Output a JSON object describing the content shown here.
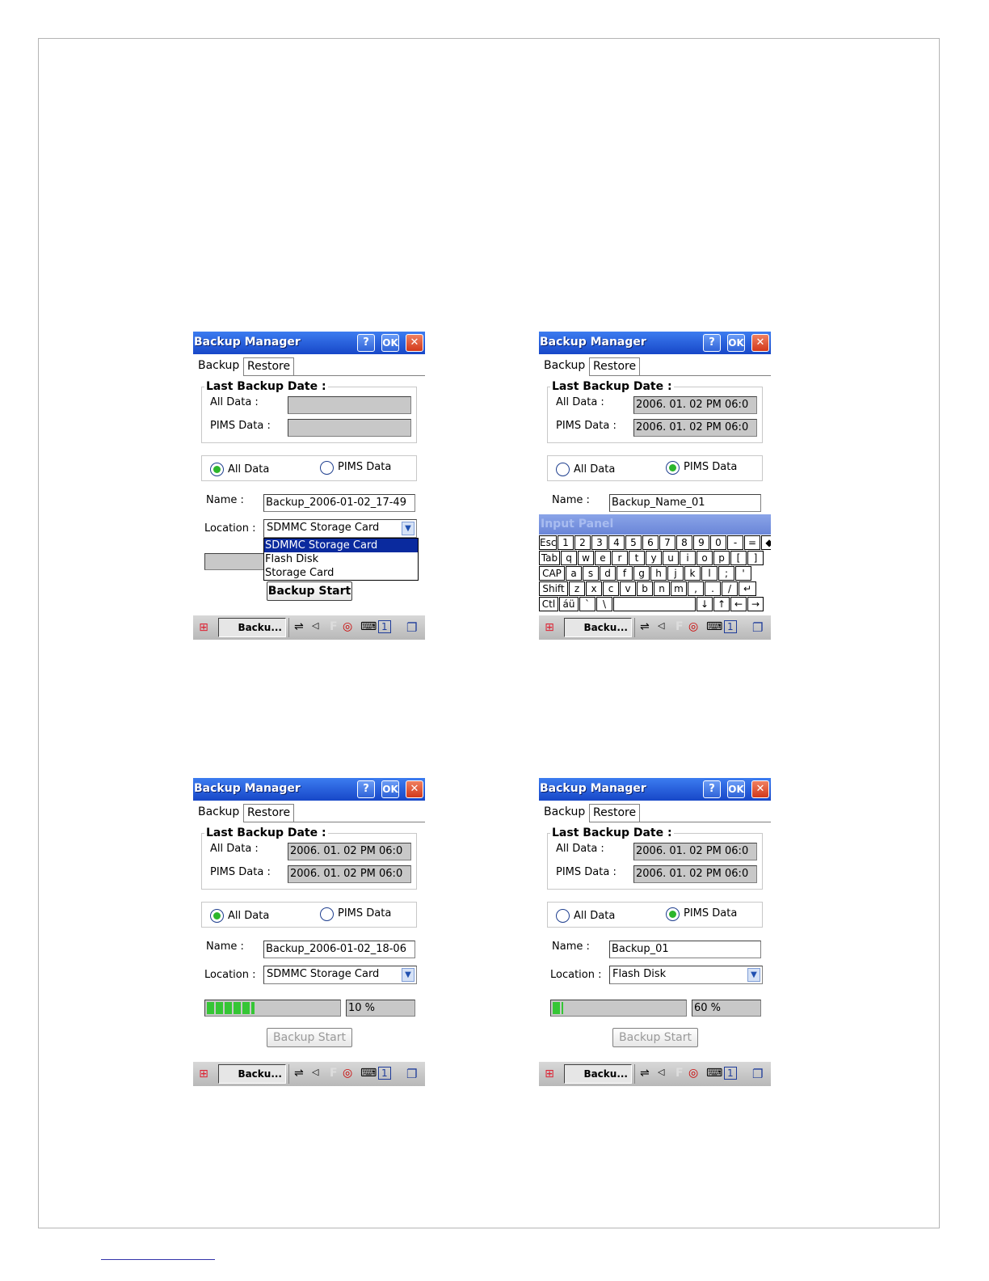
{
  "screens": [
    {
      "title": "Backup Manager",
      "title_buttons": {
        "help": "?",
        "ok": "OK",
        "close": "✕"
      },
      "tabs": {
        "backup": "Backup",
        "restore": "Restore"
      },
      "group_title": "Last Backup Date :",
      "all_data_label": "All Data :",
      "pims_data_label": "PIMS Data :",
      "all_data_value": "",
      "pims_data_value": "",
      "radio_all": "All Data",
      "radio_pims": "PIMS Data",
      "selected_radio": "all",
      "name_label": "Name :",
      "name_value": "Backup_2006-01-02_17-49",
      "location_label": "Location :",
      "location_value": "SDMMC Storage Card",
      "dropdown_options": [
        "SDMMC Storage Card",
        "Flash Disk",
        "Storage Card"
      ],
      "button_label": "Backup Start",
      "taskbar_app": "Backu..."
    },
    {
      "title": "Backup Manager",
      "title_buttons": {
        "help": "?",
        "ok": "OK",
        "close": "✕"
      },
      "tabs": {
        "backup": "Backup",
        "restore": "Restore"
      },
      "group_title": "Last Backup Date :",
      "all_data_label": "All Data :",
      "pims_data_label": "PIMS Data :",
      "all_data_value": "2006. 01. 02 PM 06:0",
      "pims_data_value": "2006. 01. 02 PM 06:0",
      "radio_all": "All Data",
      "radio_pims": "PIMS Data",
      "selected_radio": "pims",
      "name_label": "Name :",
      "name_value": "Backup_Name_01",
      "input_panel_label": "Input Panel",
      "keyboard_rows": [
        [
          "Esc",
          "1",
          "2",
          "3",
          "4",
          "5",
          "6",
          "7",
          "8",
          "9",
          "0",
          "-",
          "=",
          "◆"
        ],
        [
          "Tab",
          "q",
          "w",
          "e",
          "r",
          "t",
          "y",
          "u",
          "i",
          "o",
          "p",
          "[",
          "]"
        ],
        [
          "CAP",
          "a",
          "s",
          "d",
          "f",
          "g",
          "h",
          "j",
          "k",
          "l",
          ";",
          "'"
        ],
        [
          "Shift",
          "z",
          "x",
          "c",
          "v",
          "b",
          "n",
          "m",
          ",",
          ".",
          "/",
          "↵"
        ],
        [
          "Ctl",
          "áü",
          "`",
          "\\",
          "",
          "↓",
          "↑",
          "←",
          "→"
        ]
      ],
      "taskbar_app": "Backu..."
    },
    {
      "title": "Backup Manager",
      "title_buttons": {
        "help": "?",
        "ok": "OK",
        "close": "✕"
      },
      "tabs": {
        "backup": "Backup",
        "restore": "Restore"
      },
      "group_title": "Last Backup Date :",
      "all_data_label": "All Data :",
      "pims_data_label": "PIMS Data :",
      "all_data_value": "2006. 01. 02 PM 06:0",
      "pims_data_value": "2006. 01. 02 PM 06:0",
      "radio_all": "All Data",
      "radio_pims": "PIMS Data",
      "selected_radio": "all",
      "name_label": "Name :",
      "name_value": "Backup_2006-01-02_18-06",
      "location_label": "Location :",
      "location_value": "SDMMC Storage Card",
      "progress_percent": 10,
      "progress_fill_fraction": 0.36,
      "progress_text": "10 %",
      "button_label": "Backup Start",
      "taskbar_app": "Backu..."
    },
    {
      "title": "Backup Manager",
      "title_buttons": {
        "help": "?",
        "ok": "OK",
        "close": "✕"
      },
      "tabs": {
        "backup": "Backup",
        "restore": "Restore"
      },
      "group_title": "Last Backup Date :",
      "all_data_label": "All Data :",
      "pims_data_label": "PIMS Data :",
      "all_data_value": "2006. 01. 02 PM 06:0",
      "pims_data_value": "2006. 01. 02 PM 06:0",
      "radio_all": "All Data",
      "radio_pims": "PIMS Data",
      "selected_radio": "pims",
      "name_label": "Name :",
      "name_value": "Backup_01",
      "location_label": "Location :",
      "location_value": "Flash Disk",
      "progress_percent": 60,
      "progress_fill_fraction": 0.08,
      "progress_text": "60 %",
      "button_label": "Backup Start",
      "taskbar_app": "Backu..."
    }
  ],
  "colors": {
    "title_bar": "#1747c8",
    "progress_fill": "#35c635",
    "selection": "#0a2a9e"
  }
}
